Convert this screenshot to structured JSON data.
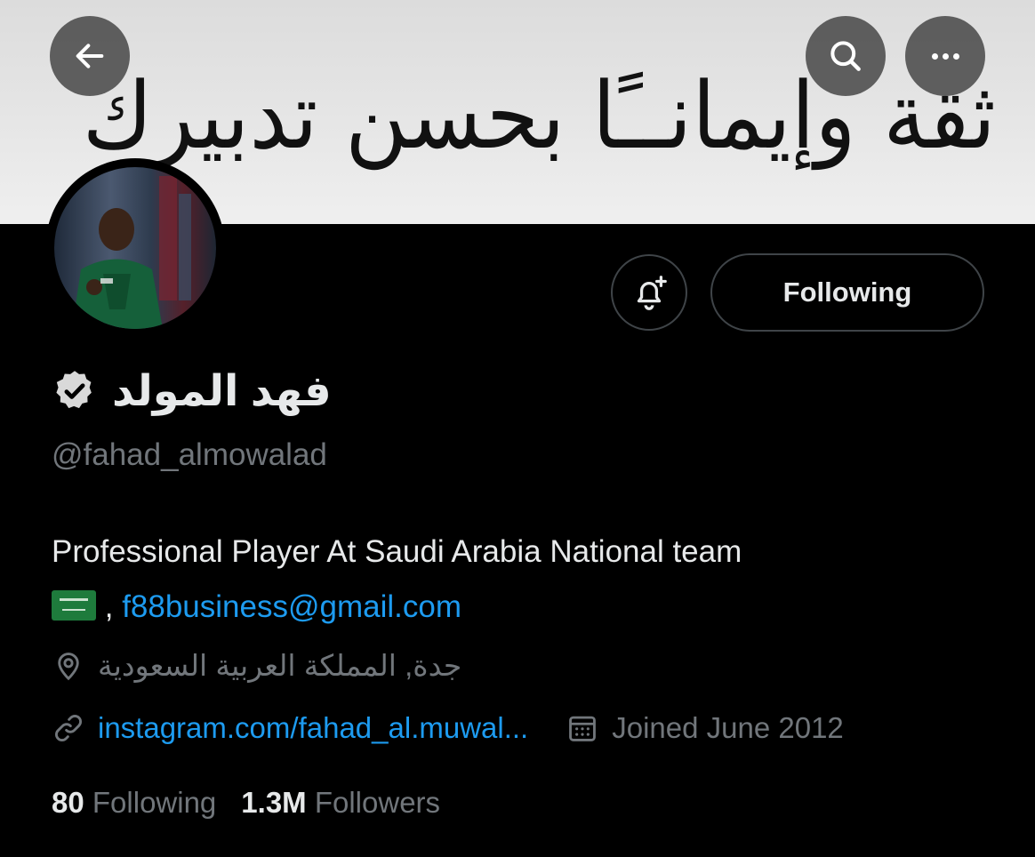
{
  "header": {
    "banner_text": "ثقة وإيمانــًا بحسن تدبيرك",
    "back_icon": "arrow-left-icon",
    "search_icon": "search-icon",
    "more_icon": "more-horizontal-icon"
  },
  "profile": {
    "display_name": "فهد المولد",
    "handle": "@fahad_almowalad",
    "verified": true,
    "bio_line1": "Professional Player At Saudi Arabia National team",
    "bio_flag": "saudi-flag-emoji",
    "bio_separator": " , ",
    "bio_email": "f88business@gmail.com",
    "location": "جدة, المملكة العربية السعودية",
    "website": "instagram.com/fahad_al.muwal...",
    "joined": "Joined June 2012"
  },
  "actions": {
    "notify_icon": "bell-plus-icon",
    "following_label": "Following"
  },
  "stats": {
    "following_count": "80",
    "following_label": "Following",
    "followers_count": "1.3M",
    "followers_label": "Followers"
  },
  "colors": {
    "background": "#000000",
    "text": "#e7e9ea",
    "muted": "#71767b",
    "link": "#1d9bf0",
    "border": "#3f4448"
  }
}
